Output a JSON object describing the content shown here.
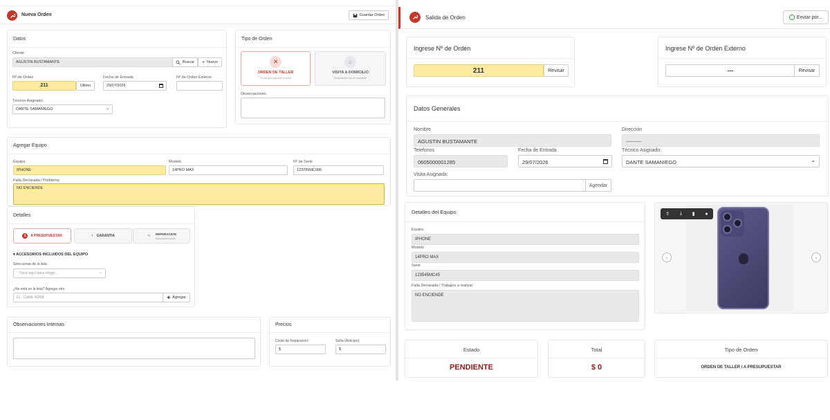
{
  "left": {
    "header": {
      "title": "Nueva Orden",
      "save_label": "Guardar Orden"
    },
    "datos": {
      "title": "Datos",
      "cliente_label": "Cliente",
      "cliente_value": "AGUSTIN BUSTAMANTE",
      "buscar_label": "Buscar",
      "nuevo_label": "Nuevo",
      "orden_label": "Nº de Orden",
      "orden_value": "211",
      "ultimo_label": "Ultimo",
      "fecha_label": "Fecha de Entrada",
      "fecha_value": "29/07/2026",
      "externo_label": "Nº de Orden Externo",
      "tecnico_label": "Técnico Asignado:",
      "tecnico_value": "DANTE SAMANIEGO"
    },
    "tipo": {
      "title": "Tipo de Orden",
      "taller_title": "ORDEN DE TALLER",
      "taller_sub": "El equipo ingresa al local",
      "domicilio_title": "VISITA A DOMICILIO",
      "domicilio_sub": "Reparación en el domicilio",
      "obs_label": "Observaciones"
    },
    "equipo": {
      "title": "Agregar Equipo",
      "equipo_label": "Equipo",
      "equipo_value": "IPHONE",
      "modelo_label": "Modelo",
      "modelo_value": "14PRO MAX",
      "serie_label": "Nº de Serie",
      "serie_value": "123789MC986",
      "falla_label": "Falla Declarada / Problema",
      "falla_value": "NO ENCIENDE"
    },
    "detalles": {
      "title": "Detalles",
      "tabs": [
        {
          "label": "A PRESUPUESTAR",
          "sub": ""
        },
        {
          "label": "GARANTIA",
          "sub": ""
        },
        {
          "label": "REPARACION",
          "sub": "Reparación previa"
        }
      ],
      "accesorios_title": "ACCESORIOS INCLUIDOS DEL EQUIPO",
      "select_label": "Seleccionar de la lista",
      "select_placeholder": "Tocá aquí para elegir...",
      "otro_label": "¿No está en la lista? Agregar otro",
      "otro_placeholder": "Ej.: Cable HDMI",
      "agregar_label": "Agregar"
    },
    "obs_internas": {
      "title": "Observaciones Internas"
    },
    "precios": {
      "title": "Precios",
      "costo_label": "Costo de Reparacion:",
      "sena_label": "Seña (Anticipo):",
      "currency": "$"
    }
  },
  "right": {
    "header": {
      "title": "Salida de Orden",
      "send_label": "Enviar por..."
    },
    "ingreso": {
      "title": "Ingrese Nº de Orden",
      "value": "211",
      "revisar": "Revisar"
    },
    "externo": {
      "title": "Ingrese Nº de Orden Externo",
      "value": "---",
      "revisar": "Revisar"
    },
    "generales": {
      "title": "Datos Generales",
      "nombre_label": "Nombre",
      "nombre_value": "AGUSTIN BUSTAMANTE",
      "direccion_label": "Dirección",
      "direccion_value": "---------",
      "telefonos_label": "Telefonos",
      "telefonos_value": "0605000001285",
      "fecha_label": "Fecha de Entrada",
      "fecha_value": "29/07/2026",
      "tecnico_label": "Técnico Asignado:",
      "tecnico_value": "DANTE SAMANIEGO",
      "visita_label": "Visita Asignada:",
      "agendar": "Agendar"
    },
    "detalles_equipo": {
      "title": "Detalles del Equipo",
      "equipo_label": "Equipo",
      "equipo_value": "IPHONE",
      "modelo_label": "Modelo",
      "modelo_value": "14PRO MAX",
      "serie_label": "Serie",
      "serie_value": "123545MC45",
      "falla_label": "Falla Declarada / Trabajos a realizar",
      "falla_value": "NO ENCIENDE"
    },
    "estado": {
      "label": "Estado",
      "value": "PENDIENTE"
    },
    "total": {
      "label": "Total",
      "value": "$ 0"
    },
    "tipo_orden": {
      "label": "Tipo de Orden",
      "value": "ORDEN DE TALLER / A PRESUPUESTAR"
    }
  },
  "colors": {
    "brand_red": "#c0392b",
    "yellow": "#fdeca0",
    "gray_field": "#e9e9eb"
  }
}
